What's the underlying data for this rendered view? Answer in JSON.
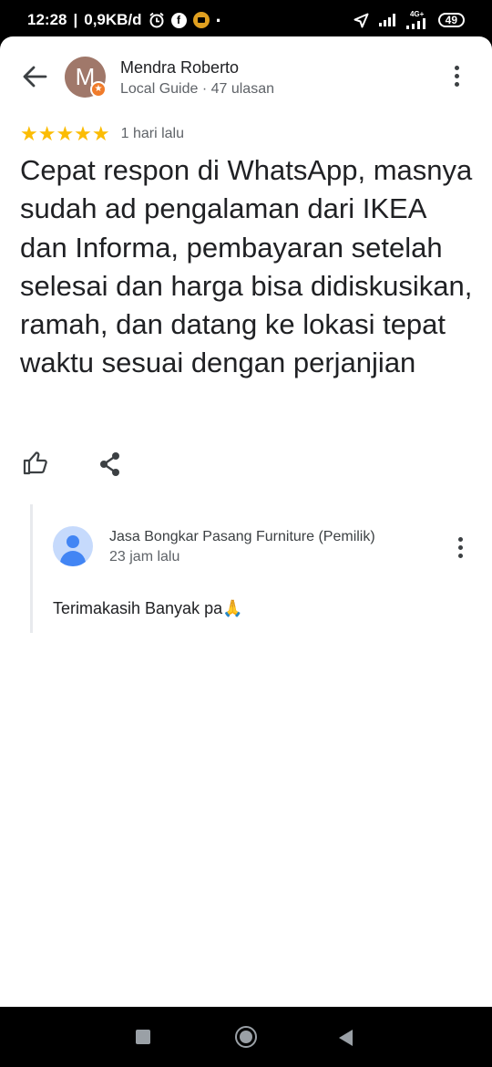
{
  "status_bar": {
    "time": "12:28",
    "network_speed": "0,9KB/d",
    "network_label": "4G+",
    "battery": "49",
    "icons": [
      "alarm-icon",
      "facebook-icon",
      "youtube-icon",
      "location-icon",
      "signal-icon",
      "signal-4g-icon",
      "battery-icon"
    ]
  },
  "review": {
    "reviewer_name": "Mendra Roberto",
    "avatar_initial": "M",
    "reviewer_meta": "Local Guide · 47 ulasan",
    "rating": 5,
    "stars": "★★★★★",
    "date": "1 hari lalu",
    "text": "Cepat respon di WhatsApp, masnya sudah ad pengalaman dari IKEA dan Informa, pembayaran setelah selesai dan harga bisa didiskusikan, ramah, dan datang ke lokasi tepat waktu sesuai dengan perjanjian"
  },
  "owner_reply": {
    "name": "Jasa Bongkar Pasang Furniture (Pemilik)",
    "time": "23 jam lalu",
    "text": "Terimakasih Banyak pa🙏"
  },
  "colors": {
    "star": "#fbbc04",
    "avatar": "#a0786a",
    "local_guide_badge": "#f07b2a",
    "owner_avatar": "#4285f4"
  }
}
